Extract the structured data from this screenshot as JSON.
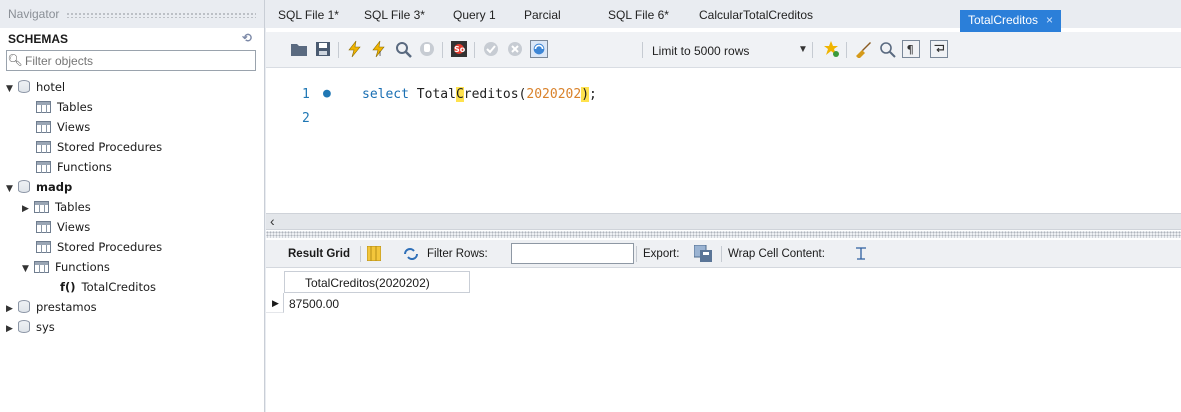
{
  "navigator": {
    "title": "Navigator",
    "schemas_label": "SCHEMAS",
    "filter_placeholder": "Filter objects",
    "tree": {
      "hotel": {
        "name": "hotel",
        "children": [
          "Tables",
          "Views",
          "Stored Procedures",
          "Functions"
        ]
      },
      "madp": {
        "name": "madp",
        "tables": "Tables",
        "views": "Views",
        "stored_procedures": "Stored Procedures",
        "functions": "Functions",
        "function_item": "TotalCreditos",
        "function_prefix": "f()"
      },
      "prestamos": "prestamos",
      "sys": "sys"
    }
  },
  "tabs": [
    "SQL File 1*",
    "SQL File 3*",
    "Query 1",
    "Parcial",
    "SQL File 6*",
    "CalcularTotalCreditos",
    "TotalCreditos"
  ],
  "active_tab_close": "×",
  "toolbar": {
    "limit_label": "Limit to 5000 rows"
  },
  "editor": {
    "lines": [
      "1",
      "2"
    ],
    "code_keyword": "select",
    "code_func_a": "Total",
    "code_func_hl": "C",
    "code_func_b": "reditos(",
    "code_number": "2020202",
    "code_close_hl": ")",
    "code_end": ";"
  },
  "results": {
    "result_grid_label": "Result Grid",
    "filter_rows_label": "Filter Rows:",
    "export_label": "Export:",
    "wrap_label": "Wrap Cell Content:",
    "column_header": "TotalCreditos(2020202)",
    "cell_value": "87500.00"
  },
  "colors": {
    "active_tab": "#2b7fd9",
    "keyword": "#1a6fb3",
    "number": "#d9822b",
    "highlight": "#ffe24d"
  }
}
